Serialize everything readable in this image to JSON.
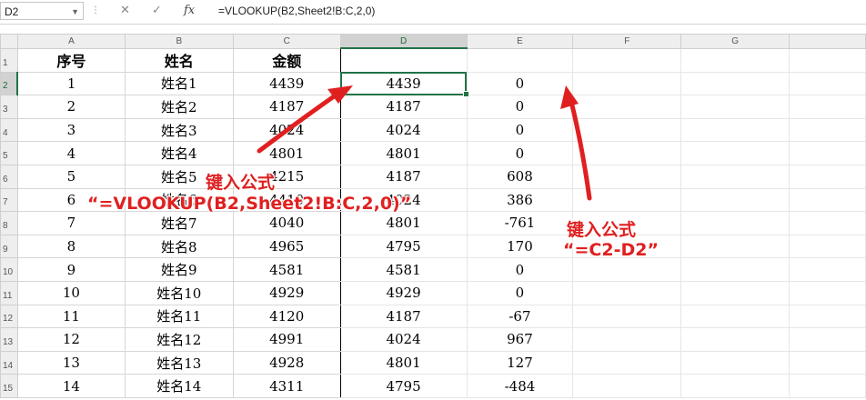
{
  "formula_bar": {
    "name_box": "D2",
    "cancel_glyph": "✕",
    "enter_glyph": "✓",
    "fx_label": "fx",
    "formula": "=VLOOKUP(B2,Sheet2!B:C,2,0)"
  },
  "columns": [
    "A",
    "B",
    "C",
    "D",
    "E",
    "F",
    "G"
  ],
  "row_numbers": [
    "1",
    "2",
    "3",
    "4",
    "5",
    "6",
    "7",
    "8",
    "9",
    "10",
    "11",
    "12",
    "13",
    "14",
    "15"
  ],
  "rows": [
    [
      "序号",
      "姓名",
      "金额",
      "",
      ""
    ],
    [
      "1",
      "姓名1",
      "4439",
      "4439",
      "0"
    ],
    [
      "2",
      "姓名2",
      "4187",
      "4187",
      "0"
    ],
    [
      "3",
      "姓名3",
      "4024",
      "4024",
      "0"
    ],
    [
      "4",
      "姓名4",
      "4801",
      "4801",
      "0"
    ],
    [
      "5",
      "姓名5",
      "4215",
      "4187",
      "608"
    ],
    [
      "6",
      "姓名6",
      "4410",
      "4024",
      "386"
    ],
    [
      "7",
      "姓名7",
      "4040",
      "4801",
      "-761"
    ],
    [
      "8",
      "姓名8",
      "4965",
      "4795",
      "170"
    ],
    [
      "9",
      "姓名9",
      "4581",
      "4581",
      "0"
    ],
    [
      "10",
      "姓名10",
      "4929",
      "4929",
      "0"
    ],
    [
      "11",
      "姓名11",
      "4120",
      "4187",
      "-67"
    ],
    [
      "12",
      "姓名12",
      "4991",
      "4024",
      "967"
    ],
    [
      "13",
      "姓名13",
      "4928",
      "4801",
      "127"
    ],
    [
      "14",
      "姓名14",
      "4311",
      "4795",
      "-484"
    ]
  ],
  "annotations": {
    "vlookup_title": "键入公式",
    "vlookup_formula": "“=VLOOKUP(B2,Sheet2!B:C,2,0)”",
    "diff_title": "键入公式",
    "diff_formula": "“=C2-D2”",
    "color": "#e02020"
  }
}
